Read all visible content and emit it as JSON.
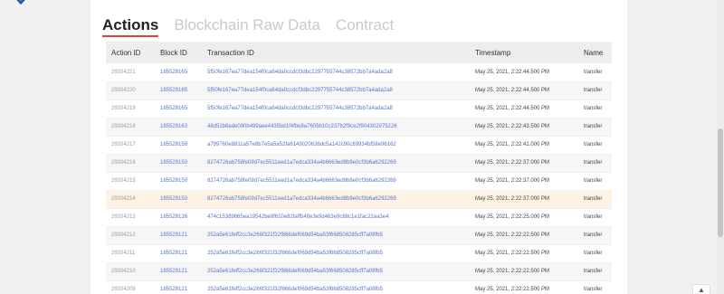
{
  "tabs": [
    {
      "label": "Actions",
      "active": true
    },
    {
      "label": "Blockchain Raw Data",
      "active": false
    },
    {
      "label": "Contract",
      "active": false
    }
  ],
  "table": {
    "headers": [
      "Action ID",
      "Block ID",
      "Transaction ID",
      "Timestamp",
      "Name"
    ],
    "rows": [
      {
        "action_id": "29204221",
        "block_id": "185529165",
        "tx": "5f50fe167ea77dea154f0ca64da0ccdcf3dbc2297755744c38572bb7a4ada2a8",
        "ts": "May 25, 2021, 2:22:44.500 PM",
        "name": "transfer"
      },
      {
        "action_id": "29204220",
        "block_id": "185529165",
        "tx": "5f50fe167ea77dea154f0ca64da0ccdcf3dbc2297755744c38572bb7a4ada2a8",
        "ts": "May 25, 2021, 2:22:44.500 PM",
        "name": "transfer"
      },
      {
        "action_id": "29204219",
        "block_id": "185529165",
        "tx": "5f50fe167ea77dea154f0ca64da0ccdcf3dbc2297755744c38572bb7a4ada2a8",
        "ts": "May 25, 2021, 2:22:44.500 PM",
        "name": "transfer"
      },
      {
        "action_id": "29204218",
        "block_id": "185529163",
        "tx": "48d52b8ade090b499aee4435bd1f4fbe8a7609b10c237b2f9ce2f904302975226",
        "ts": "May 25, 2021, 2:22:43.500 PM",
        "name": "transfer"
      },
      {
        "action_id": "29204217",
        "block_id": "185529158",
        "tx": "a799760e8811a57e8b7e5a5a52fa6149020636dc5a142c90c89934bf58e96162",
        "ts": "May 25, 2021, 2:22:41.000 PM",
        "name": "transfer"
      },
      {
        "action_id": "29204216",
        "block_id": "185529150",
        "tx": "8274726ab758fe09d7ec5511eed1a7edca334a4b6663ed8b8e0cf3b6a6292269",
        "ts": "May 25, 2021, 2:22:37.000 PM",
        "name": "transfer"
      },
      {
        "action_id": "29204215",
        "block_id": "185529150",
        "tx": "8274726ab758fe09d7ec5511eed1a7edca334a4b6663ed8b8e0cf3b6a6292269",
        "ts": "May 25, 2021, 2:22:37.000 PM",
        "name": "transfer"
      },
      {
        "action_id": "29204214",
        "block_id": "185529150",
        "tx": "8274726ab758fe09d7ec5511eed1a7edca334a4b6663ed8b8e0cf3b6a6292269",
        "ts": "May 25, 2021, 2:22:37.000 PM",
        "name": "transfer",
        "highlight": true
      },
      {
        "action_id": "29204213",
        "block_id": "185529126",
        "tx": "474c15389665ea19542be8f610e82faffb48e3e9d463e9c88c1e1fac22aa3e4",
        "ts": "May 25, 2021, 2:22:25.000 PM",
        "name": "transfer"
      },
      {
        "action_id": "29204212",
        "block_id": "185529121",
        "tx": "252a5e61feff2cc3e266f321f32f866def069d54ba53f668508285cff7a08fb5",
        "ts": "May 25, 2021, 2:22:22.500 PM",
        "name": "transfer"
      },
      {
        "action_id": "29204211",
        "block_id": "185529121",
        "tx": "252a5e61feff2cc3e266f321f32f866def069d54ba53f668508285cff7a08fb5",
        "ts": "May 25, 2021, 2:22:22.500 PM",
        "name": "transfer"
      },
      {
        "action_id": "29204210",
        "block_id": "185529121",
        "tx": "252a5e61feff2cc3e266f321f32f866def069d54ba53f668508285cff7a08fb5",
        "ts": "May 25, 2021, 2:22:22.500 PM",
        "name": "transfer"
      },
      {
        "action_id": "29204209",
        "block_id": "185529121",
        "tx": "252a5e61feff2cc3e266f321f32f866def069d54ba53f668508285cff7a08fb5",
        "ts": "May 25, 2021, 2:22:22.500 PM",
        "name": "transfer"
      }
    ]
  },
  "colors": {
    "accent_underline": "#e0423a",
    "link": "#5a73c8",
    "highlight_row": "#fdf2e3"
  },
  "icons": {
    "logo": "brand-logo-icon",
    "fab": "chevron-up-icon"
  }
}
